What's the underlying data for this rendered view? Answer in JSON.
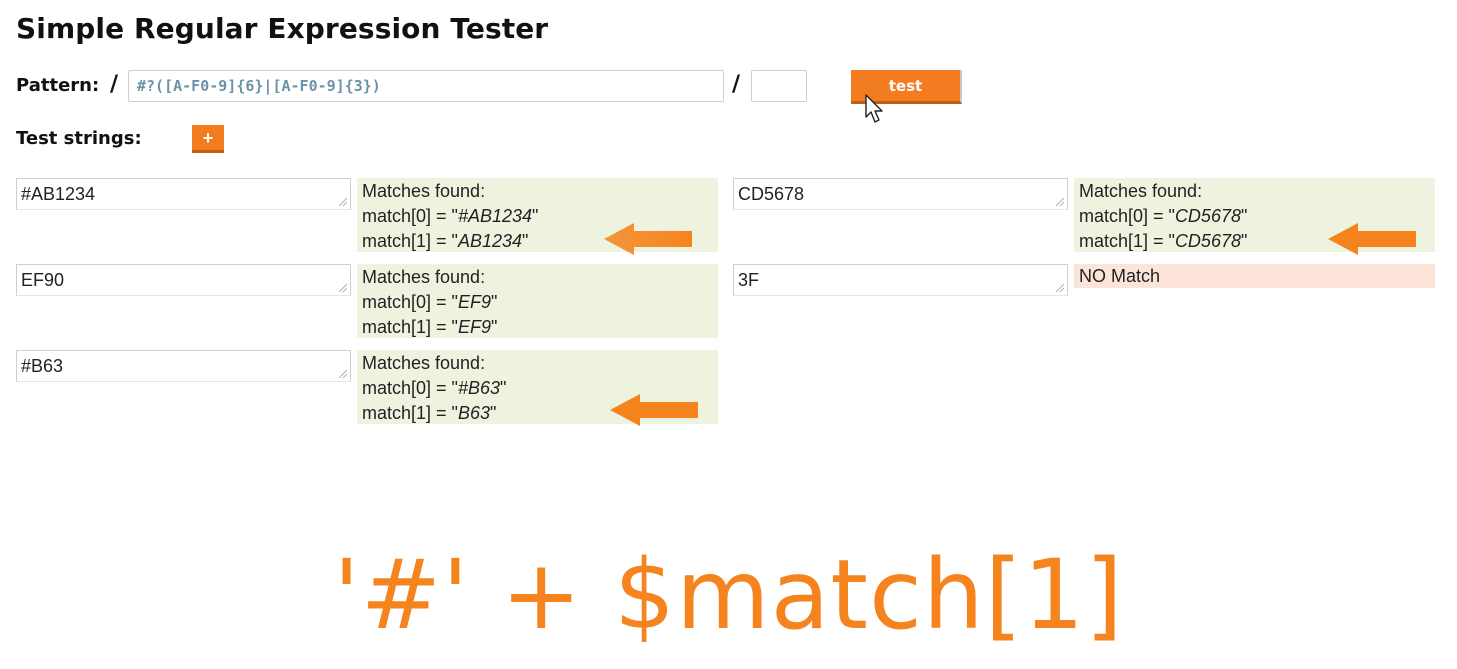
{
  "page": {
    "title": "Simple Regular Expression Tester",
    "accent_color": "#f47c20",
    "match_bg": "#eef3df",
    "nomatch_bg": "#fce4d8"
  },
  "pattern": {
    "label": "Pattern:",
    "delimiter": "/",
    "value": "#?([A-F0-9]{6}|[A-F0-9]{3})",
    "flags": "",
    "test_button_label": "test"
  },
  "test_strings": {
    "label": "Test strings:",
    "add_button_label": "+",
    "items": [
      {
        "input": "#AB1234",
        "result": {
          "heading": "Matches found:",
          "lines": [
            {
              "prefix": "match[0] = \"",
              "value": "#AB1234",
              "suffix": "\""
            },
            {
              "prefix": "match[1] = \"",
              "value": "AB1234",
              "suffix": "\""
            }
          ]
        }
      },
      {
        "input": "CD5678",
        "result": {
          "heading": "Matches found:",
          "lines": [
            {
              "prefix": "match[0] = \"",
              "value": "CD5678",
              "suffix": "\""
            },
            {
              "prefix": "match[1] = \"",
              "value": "CD5678",
              "suffix": "\""
            }
          ]
        }
      },
      {
        "input": "EF90",
        "result": {
          "heading": "Matches found:",
          "lines": [
            {
              "prefix": "match[0] = \"",
              "value": "EF9",
              "suffix": "\""
            },
            {
              "prefix": "match[1] = \"",
              "value": "EF9",
              "suffix": "\""
            }
          ]
        }
      },
      {
        "input": "3F",
        "result": {
          "heading": "NO Match"
        }
      },
      {
        "input": "#B63",
        "result": {
          "heading": "Matches found:",
          "lines": [
            {
              "prefix": "match[0] = \"",
              "value": "#B63",
              "suffix": "\""
            },
            {
              "prefix": "match[1] = \"",
              "value": "B63",
              "suffix": "\""
            }
          ]
        }
      }
    ]
  },
  "annotation": {
    "formula": "'#' + $match[1]",
    "arrow_color": "#f5841f",
    "arrow_icon": "arrow-left-icon"
  }
}
